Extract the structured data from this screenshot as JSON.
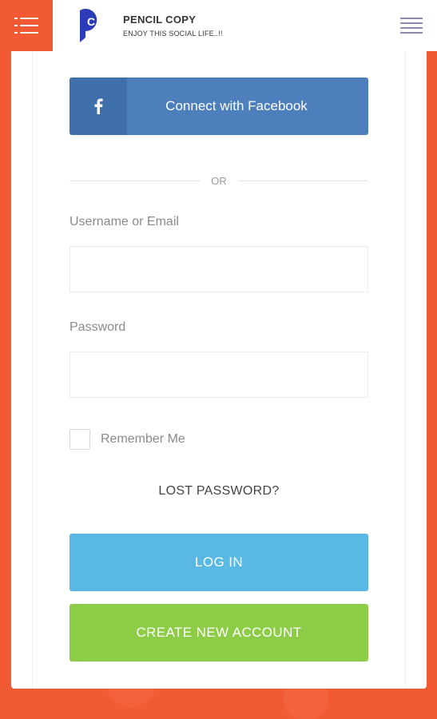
{
  "header": {
    "brand_title": "PENCIL COPY",
    "brand_subtitle": "ENJOY THIS SOCIAL LIFE..!!",
    "logo_letter": "C",
    "menu_icon": "hamburger-icon",
    "right_menu_icon": "list-menu-icon"
  },
  "login": {
    "facebook_label": "Connect with Facebook",
    "facebook_icon": "facebook-icon",
    "divider_text": "OR",
    "username_label": "Username or Email",
    "username_value": "",
    "password_label": "Password",
    "password_value": "",
    "remember_label": "Remember Me",
    "lost_password": "LOST PASSWORD?",
    "login_button": "LOG IN",
    "create_button": "CREATE NEW ACCOUNT"
  },
  "colors": {
    "accent": "#f25a33",
    "facebook": "#4c7fbc",
    "login": "#5ab8e4",
    "create": "#8dcc46",
    "logo": "#2c3cb8"
  }
}
